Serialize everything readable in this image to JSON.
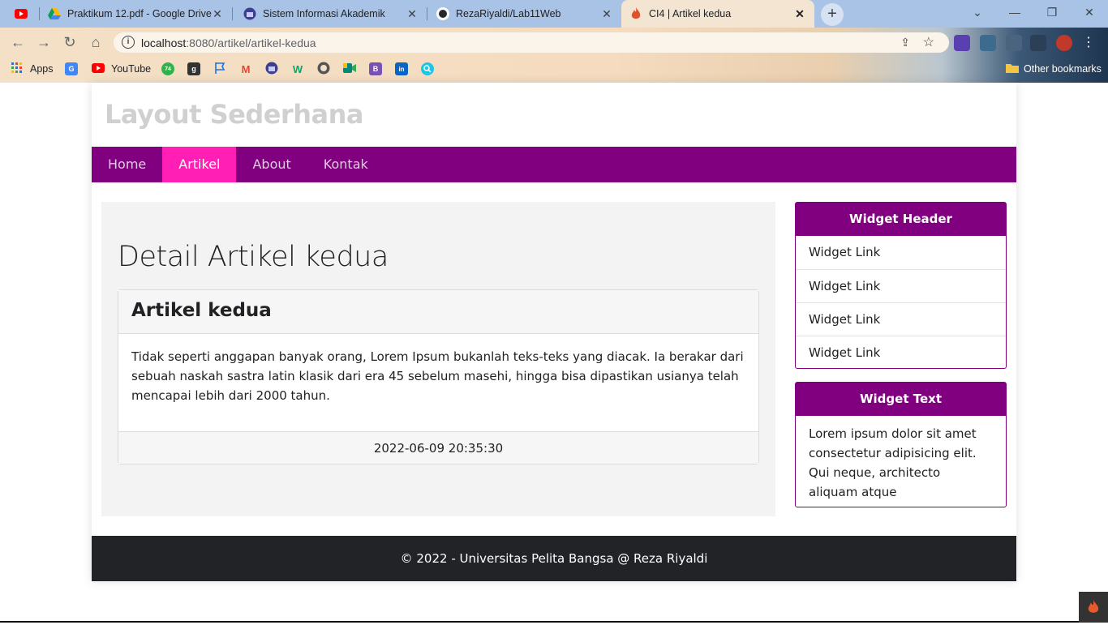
{
  "browser": {
    "tabs": [
      {
        "title": "",
        "icon": "youtube-icon"
      },
      {
        "title": "Praktikum 12.pdf - Google Drive",
        "icon": "google-drive-icon"
      },
      {
        "title": "Sistem Informasi Akademik",
        "icon": "university-icon"
      },
      {
        "title": "RezaRiyaldi/Lab11Web",
        "icon": "github-icon"
      },
      {
        "title": "CI4 | Artikel kedua",
        "icon": "codeigniter-icon",
        "active": true
      }
    ],
    "new_tab": "+",
    "window_buttons": {
      "dropdown": "⌄",
      "minimize": "—",
      "restore": "❐",
      "close": "✕"
    },
    "nav": {
      "back": "←",
      "forward": "→",
      "reload": "↻",
      "home": "⌂"
    },
    "url_host": "localhost",
    "url_rest": ":8080/artikel/artikel-kedua",
    "bookmarks": [
      {
        "label": "Apps",
        "icon": "apps-grid-icon"
      },
      {
        "label": "",
        "icon": "google-translate-icon"
      },
      {
        "label": "YouTube",
        "icon": "youtube-icon"
      },
      {
        "label": "",
        "icon": "badge-74-icon",
        "badge": "74"
      },
      {
        "label": "",
        "icon": "goodreads-icon",
        "badge": "g"
      },
      {
        "label": "",
        "icon": "flag-icon"
      },
      {
        "label": "",
        "icon": "gmail-icon",
        "badge": "M"
      },
      {
        "label": "",
        "icon": "university-icon"
      },
      {
        "label": "",
        "icon": "w3schools-icon",
        "badge": "W"
      },
      {
        "label": "",
        "icon": "github-icon"
      },
      {
        "label": "",
        "icon": "google-meet-icon"
      },
      {
        "label": "",
        "icon": "bootstrap-icon",
        "badge": "B"
      },
      {
        "label": "",
        "icon": "linkedin-icon",
        "badge": "in"
      },
      {
        "label": "",
        "icon": "search-icon"
      }
    ],
    "other_bookmarks": "Other bookmarks"
  },
  "site": {
    "title": "Layout Sederhana",
    "nav": [
      {
        "label": "Home",
        "active": false
      },
      {
        "label": "Artikel",
        "active": true
      },
      {
        "label": "About",
        "active": false
      },
      {
        "label": "Kontak",
        "active": false
      }
    ]
  },
  "main": {
    "heading": "Detail Artikel kedua",
    "article": {
      "title": "Artikel kedua",
      "body": "Tidak seperti anggapan banyak orang, Lorem Ipsum bukanlah teks-teks yang diacak. Ia berakar dari sebuah naskah sastra latin klasik dari era 45 sebelum masehi, hingga bisa dipastikan usianya telah mencapai lebih dari 2000 tahun.",
      "timestamp": "2022-06-09 20:35:30"
    }
  },
  "sidebar": {
    "widget_header": "Widget Header",
    "links": [
      "Widget Link",
      "Widget Link",
      "Widget Link",
      "Widget Link"
    ],
    "widget_text_title": "Widget Text",
    "widget_text": "Lorem ipsum dolor sit amet consectetur adipisicing elit. Qui neque, architecto aliquam atque"
  },
  "footer": {
    "text": "© 2022 - Universitas Pelita Bangsa @ Reza Riyaldi"
  },
  "colors": {
    "nav_bg": "#800080",
    "nav_active": "#ff1fb4",
    "footer_bg": "#212327"
  }
}
